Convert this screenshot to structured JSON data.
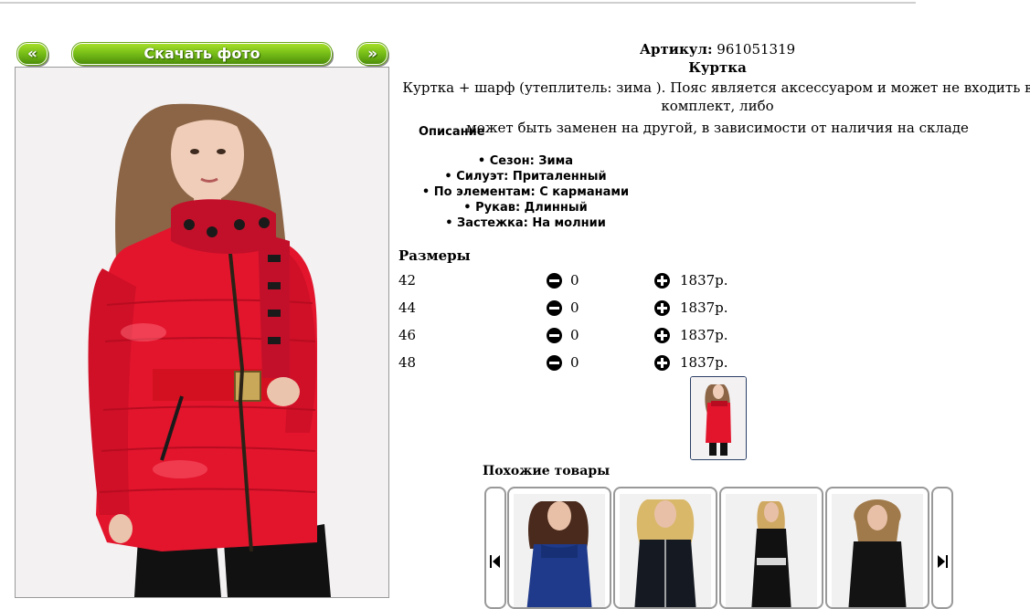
{
  "gallery": {
    "prev_label": "«",
    "download_label": "Скачать фото",
    "next_label": "»"
  },
  "product": {
    "article_label": "Артикул:",
    "article_value": "961051319",
    "name": "Куртка",
    "description_line1": "Куртка + шарф (утеплитель: зима ). Пояс является аксессуаром и может не входить в комплект, либо",
    "description_line2": "может быть заменен на другой, в зависимости от наличия на складе",
    "description_heading": "Описание",
    "features": [
      "• Сезон: Зима",
      "• Силуэт: Приталенный",
      "• По элементам: С карманами",
      "• Рукав: Длинный",
      "• Застежка: На молнии"
    ]
  },
  "sizes": {
    "heading": "Размеры",
    "rows": [
      {
        "size": "42",
        "qty": "0",
        "price": "1837р."
      },
      {
        "size": "44",
        "qty": "0",
        "price": "1837р."
      },
      {
        "size": "46",
        "qty": "0",
        "price": "1837р."
      },
      {
        "size": "48",
        "qty": "0",
        "price": "1837р."
      }
    ]
  },
  "similar": {
    "heading": "Похожие товары"
  },
  "colors": {
    "button_green": "#79c018",
    "jacket_red": "#e3152d",
    "thumb_border": "#2a3f64"
  }
}
